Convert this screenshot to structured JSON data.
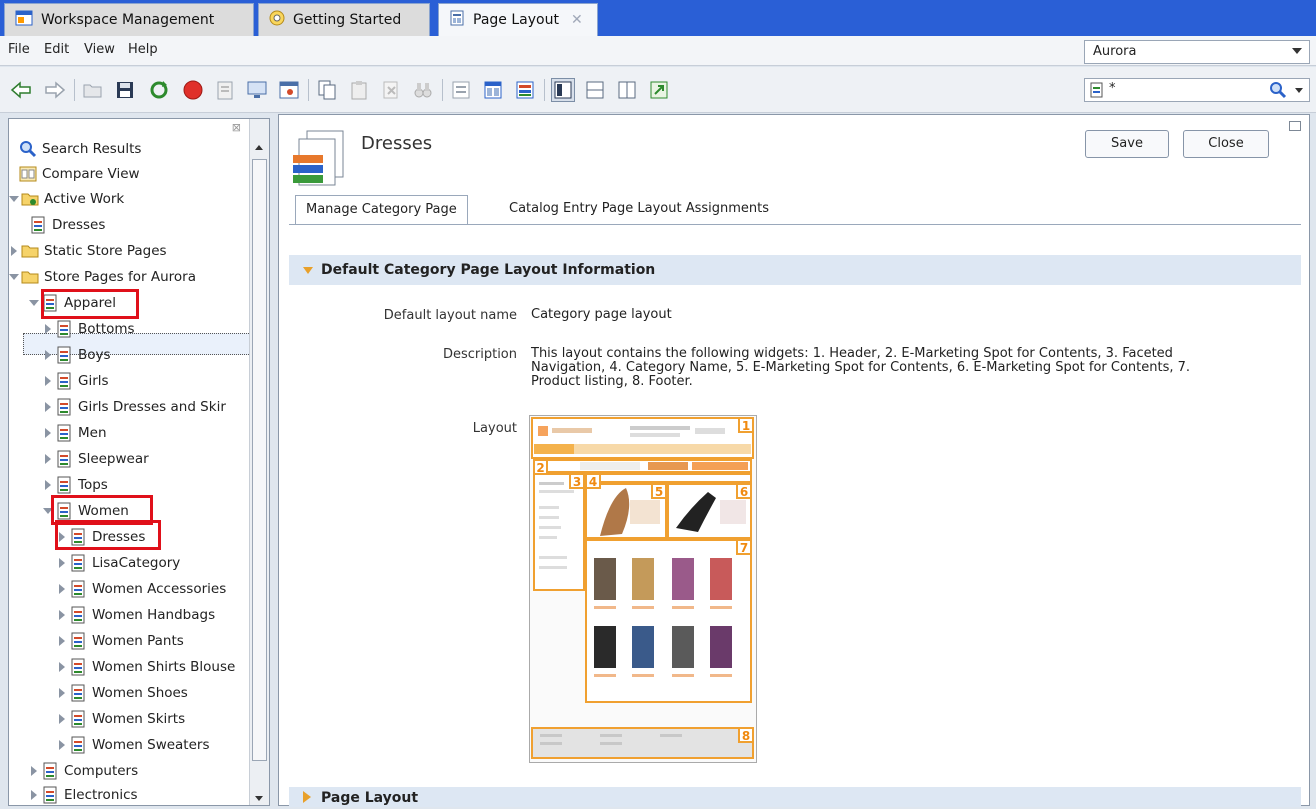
{
  "tabs": [
    {
      "label": "Workspace Management",
      "active": false
    },
    {
      "label": "Getting Started",
      "active": false
    },
    {
      "label": "Page Layout",
      "active": true
    }
  ],
  "menu": [
    "File",
    "Edit",
    "View",
    "Help"
  ],
  "store_select": {
    "value": "Aurora"
  },
  "search": {
    "value": "*"
  },
  "tree": {
    "items": [
      {
        "label": "Search Results",
        "icon": "search-icon"
      },
      {
        "label": "Compare View",
        "icon": "compare-icon"
      },
      {
        "label": "Active Work",
        "icon": "folder-icon"
      },
      {
        "label": "Dresses",
        "icon": "page-icon"
      },
      {
        "label": "Static Store Pages",
        "icon": "folder-icon"
      },
      {
        "label": "Store Pages for Aurora",
        "icon": "folder-icon"
      },
      {
        "label": "Apparel",
        "icon": "page-icon"
      },
      {
        "label": "Bottoms",
        "icon": "page-icon"
      },
      {
        "label": "Boys",
        "icon": "page-icon"
      },
      {
        "label": "Girls",
        "icon": "page-icon"
      },
      {
        "label": "Girls Dresses and Skir",
        "icon": "page-icon"
      },
      {
        "label": "Men",
        "icon": "page-icon"
      },
      {
        "label": "Sleepwear",
        "icon": "page-icon"
      },
      {
        "label": "Tops",
        "icon": "page-icon"
      },
      {
        "label": "Women",
        "icon": "page-icon"
      },
      {
        "label": "Dresses",
        "icon": "page-icon"
      },
      {
        "label": "LisaCategory",
        "icon": "page-icon"
      },
      {
        "label": "Women Accessories",
        "icon": "page-icon"
      },
      {
        "label": "Women Handbags",
        "icon": "page-icon"
      },
      {
        "label": "Women Pants",
        "icon": "page-icon"
      },
      {
        "label": "Women Shirts Blouse",
        "icon": "page-icon"
      },
      {
        "label": "Women Shoes",
        "icon": "page-icon"
      },
      {
        "label": "Women Skirts",
        "icon": "page-icon"
      },
      {
        "label": "Women Sweaters",
        "icon": "page-icon"
      },
      {
        "label": "Computers",
        "icon": "page-icon"
      },
      {
        "label": "Electronics",
        "icon": "page-icon"
      }
    ]
  },
  "editor": {
    "title": "Dresses",
    "save_label": "Save",
    "close_label": "Close",
    "subtabs": [
      "Manage Category Page",
      "Catalog Entry Page Layout Assignments"
    ],
    "section1_title": "Default Category Page Layout Information",
    "default_layout_name_label": "Default layout name",
    "default_layout_name": "Category page layout",
    "description_label": "Description",
    "description_line1": "This layout contains the following widgets: 1. Header, 2. E-Marketing Spot for Contents, 3. Faceted",
    "description_line2": "Navigation, 4. Category Name, 5. E-Marketing Spot for Contents, 6. E-Marketing Spot for Contents, 7.",
    "description_line3": "Product listing, 8. Footer.",
    "layout_label": "Layout",
    "layout_slots": [
      "1",
      "2",
      "3",
      "4",
      "5",
      "6",
      "7",
      "8"
    ],
    "section2_title": "Page Layout"
  },
  "colors": {
    "tabbar": "#2a5fd6",
    "highlight_box": "#e0101a",
    "layout_slot": "#f0a030",
    "section_header": "#dde7f3"
  }
}
